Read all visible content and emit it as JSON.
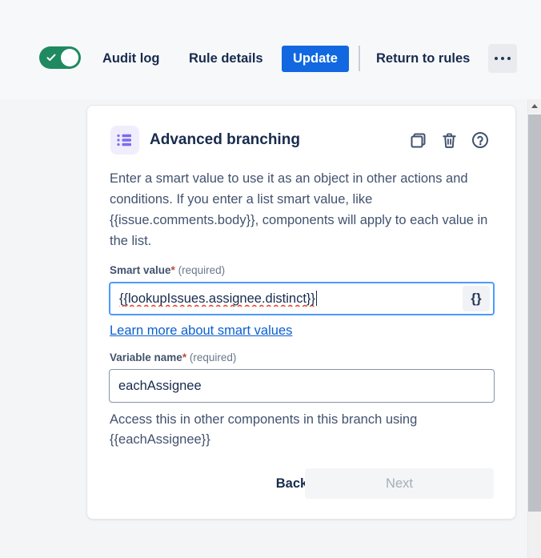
{
  "toolbar": {
    "toggle": {
      "name": "rule-enabled-toggle",
      "state": "on",
      "color": "#1f8a5f"
    },
    "audit_log_label": "Audit log",
    "rule_details_label": "Rule details",
    "update_label": "Update",
    "return_to_rules_label": "Return to rules",
    "more_actions_label": "•••"
  },
  "card": {
    "icon": "bulleted-list-icon",
    "title": "Advanced branching",
    "header_actions": {
      "duplicate": "duplicate-icon",
      "delete": "trash-icon",
      "help": "help-circle-icon"
    },
    "description": "Enter a smart value to use it as an object in other actions and conditions. If you enter a list smart value, like {{issue.comments.body}}, components will apply to each value in the list.",
    "smart_value": {
      "label": "Smart value",
      "required_star": "*",
      "required_text": "(required)",
      "value": "{{lookupIssues.assignee.distinct}}",
      "placeholder": "",
      "picker_button_label": "{}",
      "link_text": "Learn more about smart values"
    },
    "variable_name": {
      "label": "Variable name",
      "required_star": "*",
      "required_text": "(required)",
      "value": "eachAssignee",
      "placeholder": "",
      "help_text": "Access this in other components in this branch using {{eachAssignee}}"
    },
    "footer": {
      "back_label": "Back",
      "next_label": "Next"
    }
  },
  "colors": {
    "page_background": "#f4f5f7",
    "primary_button": "#1168e0",
    "toggle_on": "#1f8a5f",
    "focus_border": "#4c9aff",
    "link": "#0b5fd0",
    "accent_icon": "#7b6cf0"
  }
}
